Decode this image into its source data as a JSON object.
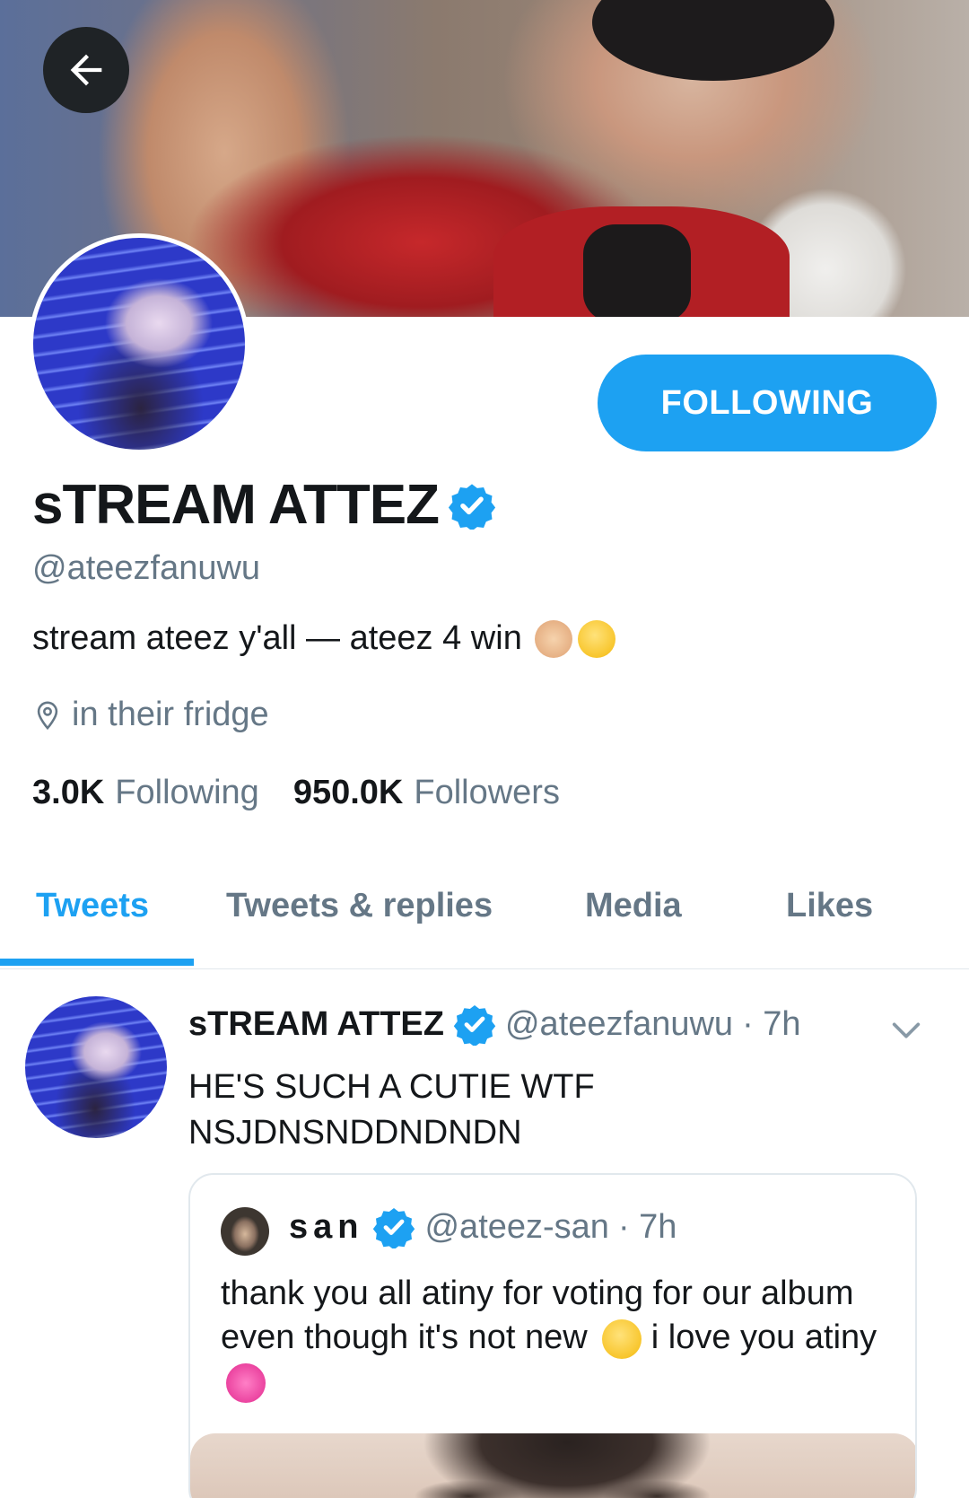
{
  "profile": {
    "display_name": "sTREAM ATTEZ",
    "handle": "@ateezfanuwu",
    "bio": "stream ateez y'all — ateez 4 win",
    "location": "in their fridge",
    "following_count": "3.0K",
    "following_label": "Following",
    "followers_count": "950.0K",
    "followers_label": "Followers",
    "follow_button_label": "FOLLOWING",
    "verified": true
  },
  "tabs": [
    {
      "label": "Tweets",
      "active": true
    },
    {
      "label": "Tweets & replies",
      "active": false
    },
    {
      "label": "Media",
      "active": false
    },
    {
      "label": "Likes",
      "active": false
    }
  ],
  "tweet": {
    "name": "sTREAM ATTEZ",
    "handle": "@ateezfanuwu",
    "time": "· 7h",
    "text_line1": "HE'S SUCH A CUTIE WTF",
    "text_line2": "NSJDNSNDDNDNDN",
    "quote": {
      "name": "san",
      "handle": "@ateez-san",
      "time": "· 7h",
      "text_part1": "thank you all atiny for voting for our album even though it's not new",
      "text_part2": "i love you atiny"
    }
  },
  "icons": {
    "back": "arrow-left-icon",
    "verified": "verified-badge-icon",
    "location": "location-pin-icon",
    "chevron": "chevron-down-icon"
  },
  "colors": {
    "accent": "#1da1f2",
    "secondary_text": "#657786",
    "primary_text": "#14171a"
  }
}
